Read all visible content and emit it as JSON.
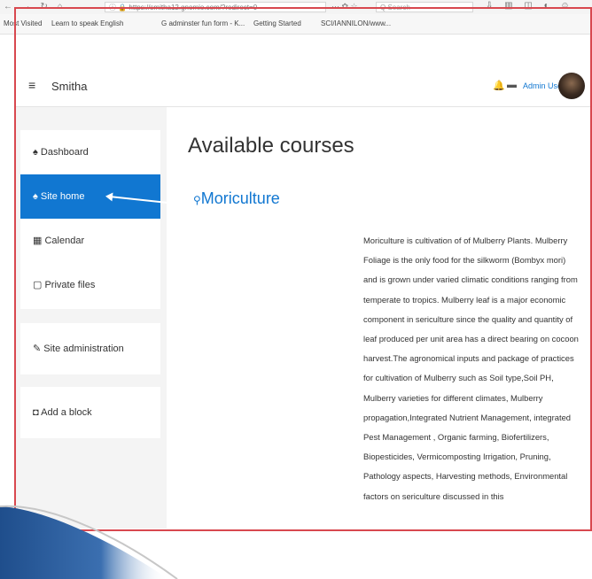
{
  "browser": {
    "nav_glyphs": "← → ↻ ⌂",
    "url": "ⓘ 🔒 https://smitha12.gnomio.com/?redirect=0",
    "page_actions": "··· ✿ ☆",
    "search_placeholder": "Q Search",
    "toolbar_glyphs": "⇩ ▥ ◫ ◐ ☺"
  },
  "bookmarks": [
    {
      "label": "Most Visited"
    },
    {
      "label": "Learn to speak English"
    },
    {
      "label": "G adminster fun form - K..."
    },
    {
      "label": "Getting Started"
    },
    {
      "label": "SCI/IANNILON/www..."
    }
  ],
  "app": {
    "menu_glyph": "≡",
    "site_name": "Smitha",
    "bell_glyph": "🔔",
    "messages_glyph": "▬",
    "user_name": "Admin User"
  },
  "sidebar": {
    "items": [
      {
        "label": "Dashboard",
        "icon": "♠"
      },
      {
        "label": "Site home",
        "icon": "♠"
      },
      {
        "label": "Calendar",
        "icon": "▦"
      },
      {
        "label": "Private files",
        "icon": "▢"
      },
      {
        "label": "Site administration",
        "icon": "✎"
      },
      {
        "label": "Add a block",
        "icon": "◘"
      }
    ]
  },
  "main": {
    "title": "Available courses",
    "course": {
      "icon": "⚲",
      "name": "Moriculture",
      "summary": "Moriculture is cultivation of of Mulberry Plants. Mulberry Foliage is the only food for the silkworm (Bombyx mori) and is grown under varied climatic conditions ranging from temperate to tropics. Mulberry leaf is a major economic component in sericulture since the quality and quantity of leaf produced per unit area has a direct bearing on cocoon harvest.The agronomical inputs and package of practices for cultivation of Mulberry such as Soil type,Soil PH, Mulberry varieties for different climates, Mulberry propagation,Integrated Nutrient Management, integrated Pest Management , Organic farming, Biofertilizers, Biopesticides, Vermicomposting Irrigation, Pruning, Pathology aspects, Harvesting methods, Environmental factors on sericulture discussed in this"
    }
  },
  "colors": {
    "accent": "#1177d1",
    "frame": "#d8484f",
    "swoosh": "#1f4e8c"
  }
}
